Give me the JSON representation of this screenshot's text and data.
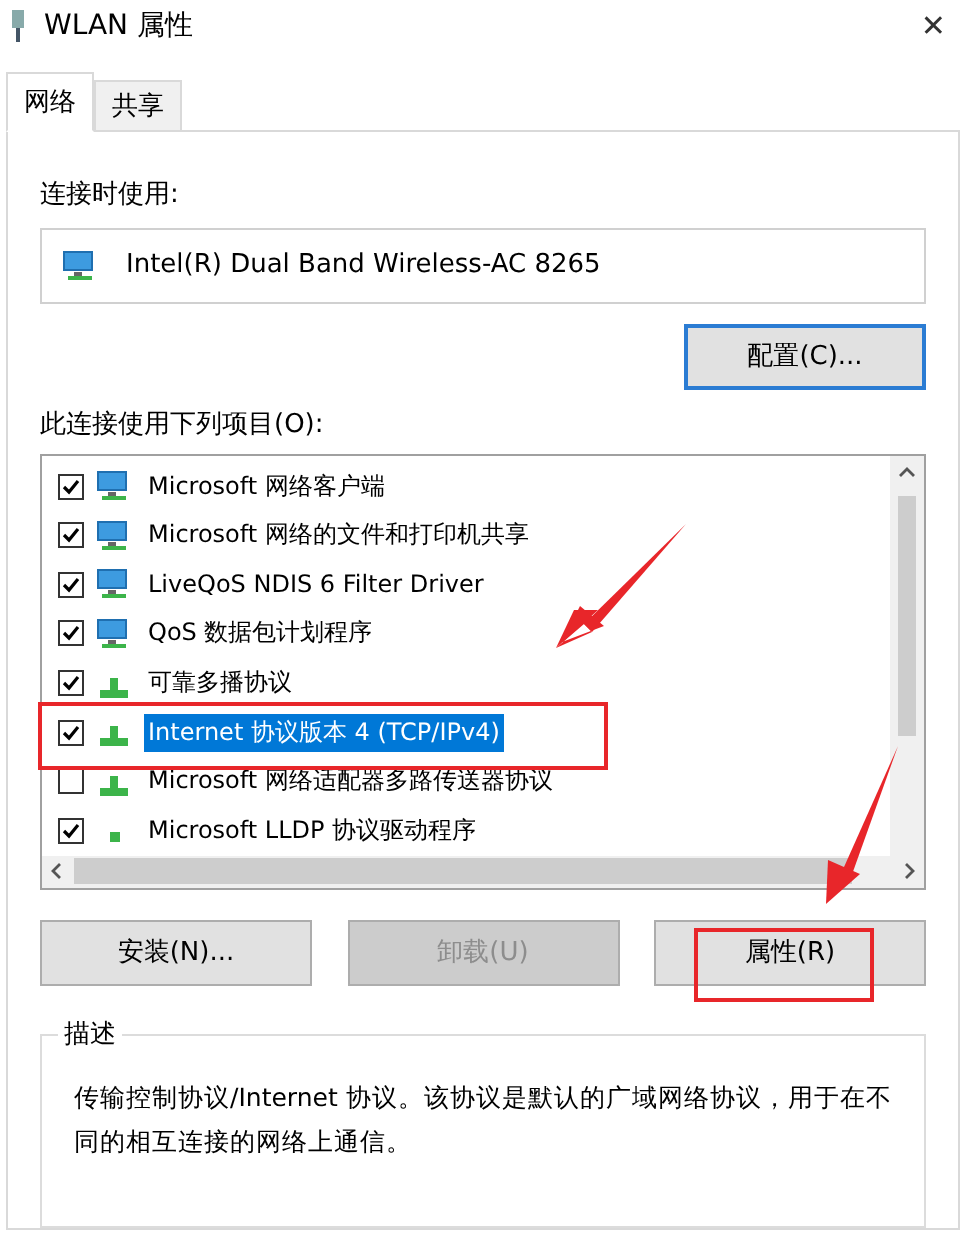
{
  "window": {
    "title": "WLAN 属性",
    "close": "✕"
  },
  "tabs": [
    {
      "label": "网络",
      "selected": true
    },
    {
      "label": "共享",
      "selected": false
    }
  ],
  "connect_using": {
    "label": "连接时使用:",
    "adapter": "Intel(R) Dual Band Wireless-AC 8265",
    "configure_button": "配置(C)..."
  },
  "items_label": "此连接使用下列项目(O):",
  "items": [
    {
      "label": "Microsoft 网络客户端",
      "checked": true,
      "selected": false,
      "kind": "network"
    },
    {
      "label": "Microsoft 网络的文件和打印机共享",
      "checked": true,
      "selected": false,
      "kind": "network"
    },
    {
      "label": "LiveQoS NDIS 6 Filter Driver",
      "checked": true,
      "selected": false,
      "kind": "network"
    },
    {
      "label": "QoS 数据包计划程序",
      "checked": true,
      "selected": false,
      "kind": "network"
    },
    {
      "label": "可靠多播协议",
      "checked": true,
      "selected": false,
      "kind": "protocol"
    },
    {
      "label": "Internet 协议版本 4 (TCP/IPv4)",
      "checked": true,
      "selected": true,
      "kind": "protocol"
    },
    {
      "label": "Microsoft 网络适配器多路传送器协议",
      "checked": false,
      "selected": false,
      "kind": "protocol"
    },
    {
      "label": "Microsoft LLDP 协议驱动程序",
      "checked": true,
      "selected": false,
      "kind": "driver"
    }
  ],
  "buttons": [
    {
      "label": "安装(N)...",
      "disabled": false
    },
    {
      "label": "卸载(U)",
      "disabled": true
    },
    {
      "label": "属性(R)",
      "disabled": false
    }
  ],
  "description": {
    "legend": "描述",
    "text": "传输控制协议/Internet 协议。该协议是默认的广域网络协议，用于在不同的相互连接的网络上通信。"
  }
}
